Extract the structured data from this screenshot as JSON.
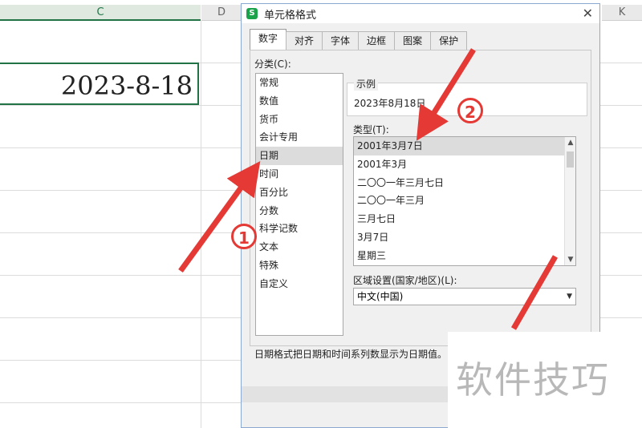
{
  "sheet": {
    "columns": [
      "C",
      "D",
      "K"
    ],
    "cell_value": "2023-8-18"
  },
  "dialog": {
    "title": "单元格格式",
    "close_glyph": "✕",
    "tabs": [
      "数字",
      "对齐",
      "字体",
      "边框",
      "图案",
      "保护"
    ],
    "category_label": "分类(C):",
    "categories": [
      "常规",
      "数值",
      "货币",
      "会计专用",
      "日期",
      "时间",
      "百分比",
      "分数",
      "科学记数",
      "文本",
      "特殊",
      "自定义"
    ],
    "selected_category": "日期",
    "sample_label": "示例",
    "sample_value": "2023年8月18日",
    "type_label": "类型(T):",
    "types": [
      "2001年3月7日",
      "2001年3月",
      "二〇〇一年三月七日",
      "二〇〇一年三月",
      "三月七日",
      "3月7日",
      "星期三"
    ],
    "selected_type": "2001年3月7日",
    "locale_label": "区域设置(国家/地区)(L):",
    "locale_value": "中文(中国)",
    "description": "日期格式把日期和时间系列数显示为日期值。"
  },
  "annotations": {
    "badge_1": "1",
    "badge_2": "2",
    "arrow_color": "#e53935"
  },
  "watermark": "软件技巧"
}
